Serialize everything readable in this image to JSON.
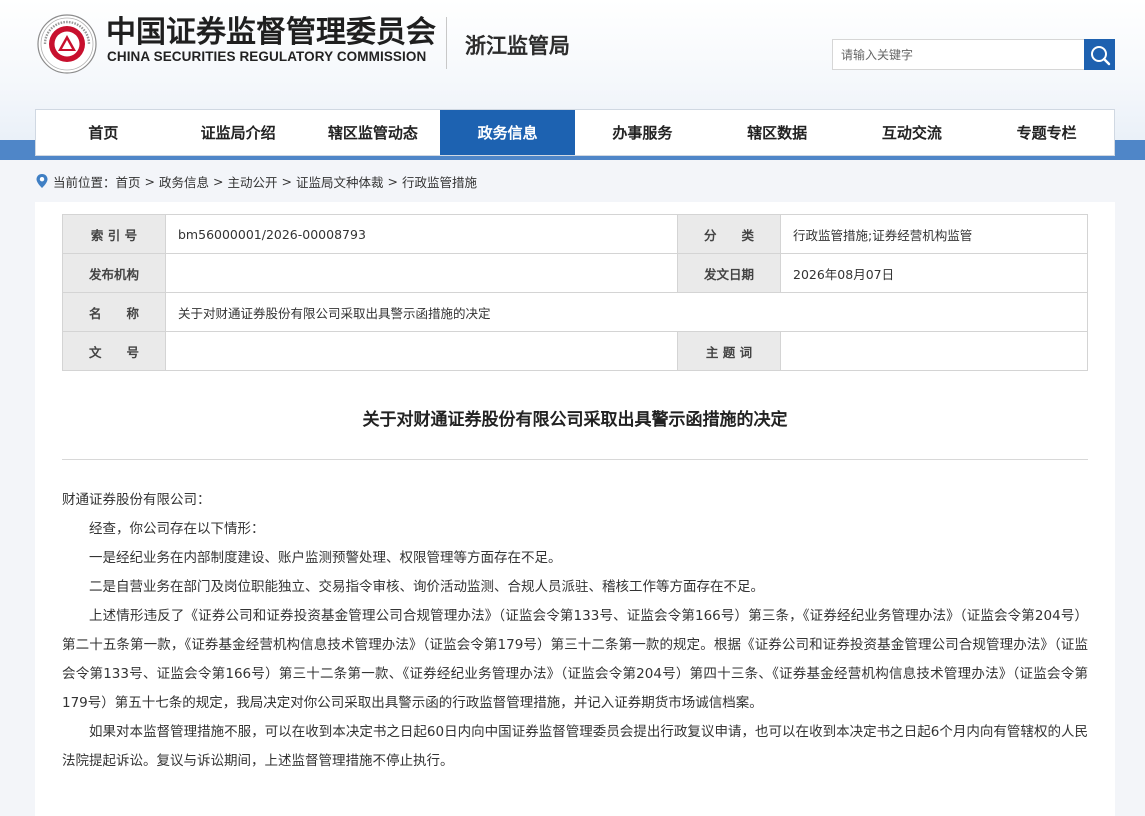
{
  "header": {
    "org_name_cn": "中国证券监督管理委员会",
    "org_name_en": "CHINA SECURITIES REGULATORY COMMISSION",
    "bureau": "浙江监管局",
    "emblem_icon": "csrc-emblem-icon",
    "brand_color": "#c8102e"
  },
  "search": {
    "placeholder": "请输入关键字",
    "button_icon": "search-icon",
    "button_color": "#1e61b0"
  },
  "nav": {
    "items": [
      "首页",
      "证监局介绍",
      "辖区监管动态",
      "政务信息",
      "办事服务",
      "辖区数据",
      "互动交流",
      "专题专栏"
    ],
    "active": "政务信息",
    "active_color": "#1d62b1"
  },
  "breadcrumb": {
    "prefix": "当前位置：",
    "items": [
      "首页",
      "政务信息",
      "主动公开",
      "证监局文种体裁",
      "行政监管措施"
    ],
    "separator": ">"
  },
  "meta": {
    "index_label": "索 引 号",
    "index_value": "bm56000001/2026-00008793",
    "category_label": "分　　类",
    "category_value": "行政监管措施;证券经营机构监管",
    "publisher_label": "发布机构",
    "publisher_value": "",
    "date_label": "发文日期",
    "date_value": "2026年08月07日",
    "name_label": "名　　称",
    "name_value": "关于对财通证券股份有限公司采取出具警示函措施的决定",
    "docno_label": "文　　号",
    "docno_value": "",
    "keywords_label": "主 题 词",
    "keywords_value": ""
  },
  "document": {
    "title": "关于对财通证券股份有限公司采取出具警示函措施的决定",
    "addressee": "财通证券股份有限公司：",
    "paragraphs": [
      "经查，你公司存在以下情形：",
      "一是经纪业务在内部制度建设、账户监测预警处理、权限管理等方面存在不足。",
      "二是自营业务在部门及岗位职能独立、交易指令审核、询价活动监测、合规人员派驻、稽核工作等方面存在不足。",
      "上述情形违反了《证券公司和证券投资基金管理公司合规管理办法》（证监会令第133号、证监会令第166号）第三条，《证券经纪业务管理办法》（证监会令第204号）第二十五条第一款，《证券基金经营机构信息技术管理办法》（证监会令第179号）第三十二条第一款的规定。根据《证券公司和证券投资基金管理公司合规管理办法》（证监会令第133号、证监会令第166号）第三十二条第一款、《证券经纪业务管理办法》（证监会令第204号）第四十三条、《证券基金经营机构信息技术管理办法》（证监会令第179号）第五十七条的规定，我局决定对你公司采取出具警示函的行政监督管理措施，并记入证券期货市场诚信档案。",
      "如果对本监督管理措施不服，可以在收到本决定书之日起60日内向中国证券监督管理委员会提出行政复议申请，也可以在收到本决定书之日起6个月内向有管辖权的人民法院提起诉讼。复议与诉讼期间，上述监督管理措施不停止执行。"
    ]
  }
}
